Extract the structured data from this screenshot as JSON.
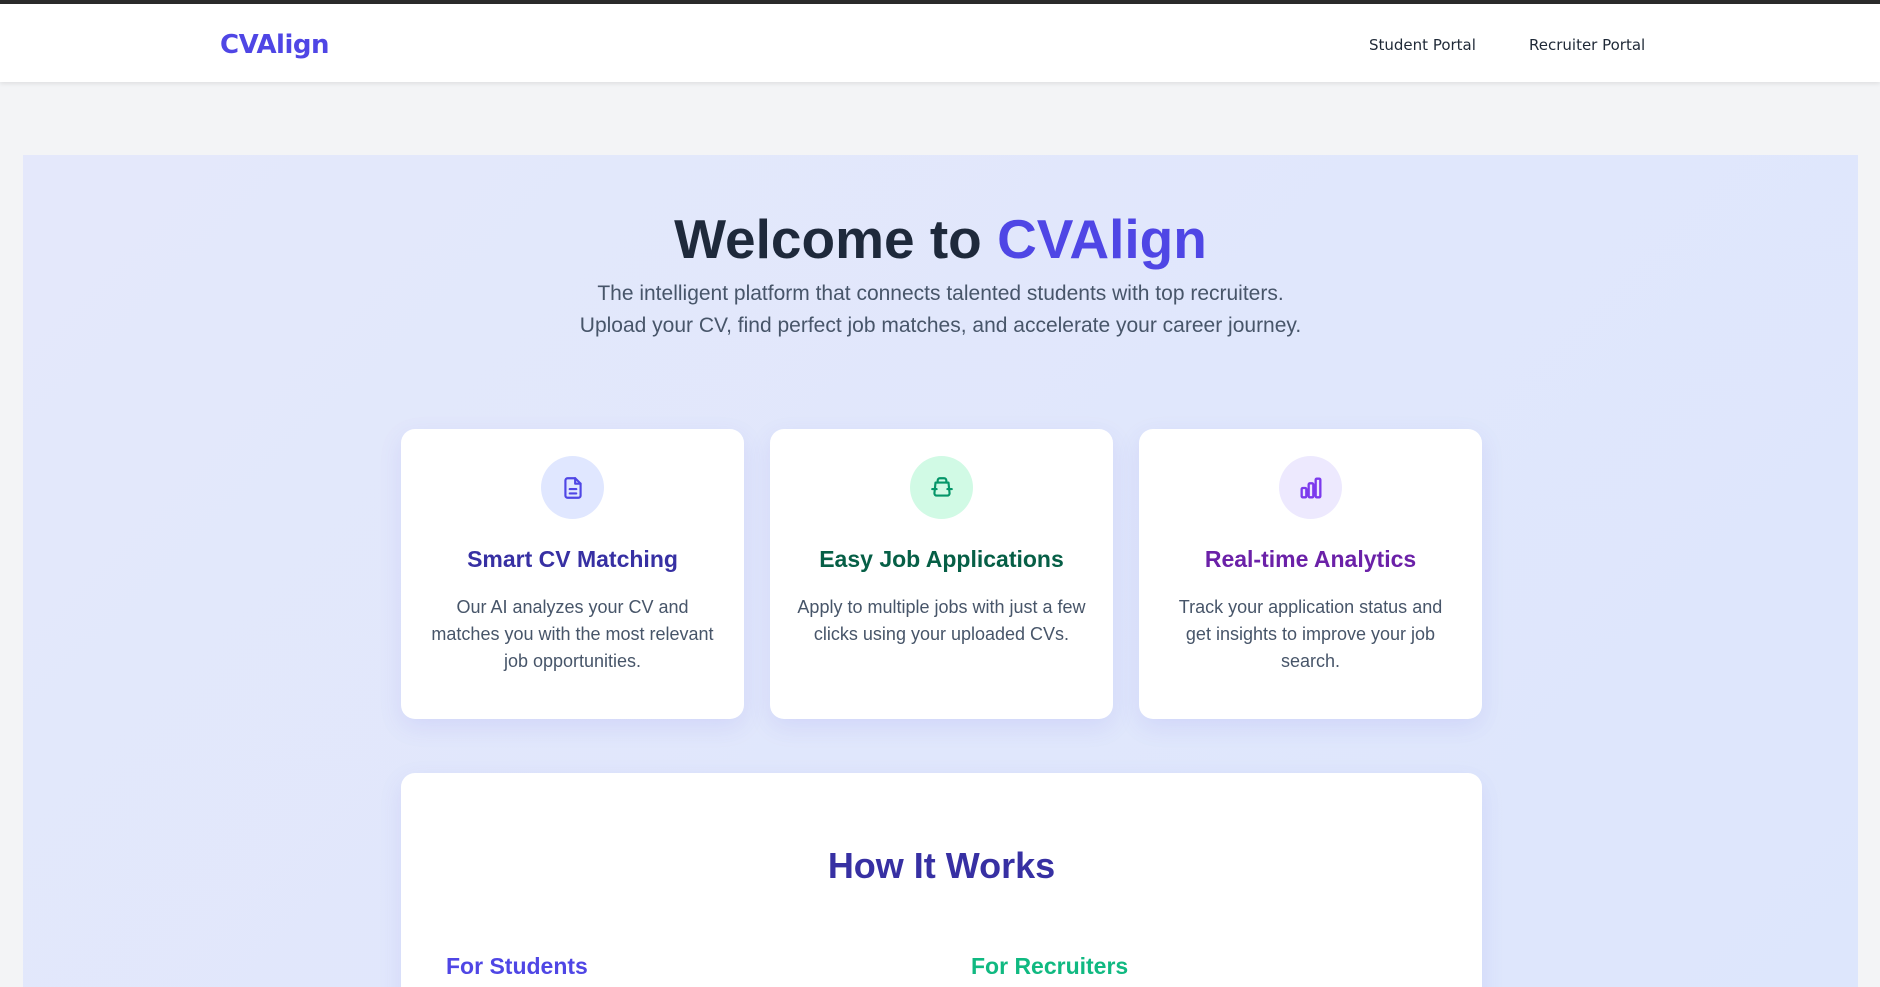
{
  "navbar": {
    "brand": "CVAlign",
    "links": [
      {
        "label": "Student Portal"
      },
      {
        "label": "Recruiter Portal"
      }
    ]
  },
  "hero": {
    "title_prefix": "Welcome to ",
    "title_accent": "CVAlign",
    "subtitle": "The intelligent platform that connects talented students with top recruiters. Upload your CV, find perfect job matches, and accelerate your career journey."
  },
  "features": [
    {
      "icon": "document-icon",
      "title": "Smart CV Matching",
      "description": "Our AI analyzes your CV and matches you with the most relevant job opportunities.",
      "title_color": "#3730a3",
      "icon_color": "#4f46e5",
      "icon_bg": "#e0e7ff"
    },
    {
      "icon": "briefcase-icon",
      "title": "Easy Job Applications",
      "description": "Apply to multiple jobs with just a few clicks using your uploaded CVs.",
      "title_color": "#065f46",
      "icon_color": "#059669",
      "icon_bg": "#d1fae5"
    },
    {
      "icon": "bar-chart-icon",
      "title": "Real-time Analytics",
      "description": "Track your application status and get insights to improve your job search.",
      "title_color": "#6b21a8",
      "icon_color": "#7c3aed",
      "icon_bg": "#ede9fe"
    }
  ],
  "how_it_works": {
    "title": "How It Works",
    "students_heading": "For Students",
    "recruiters_heading": "For Recruiters"
  },
  "colors": {
    "brand": "#4f46e5",
    "recruiter_accent": "#10b981"
  }
}
